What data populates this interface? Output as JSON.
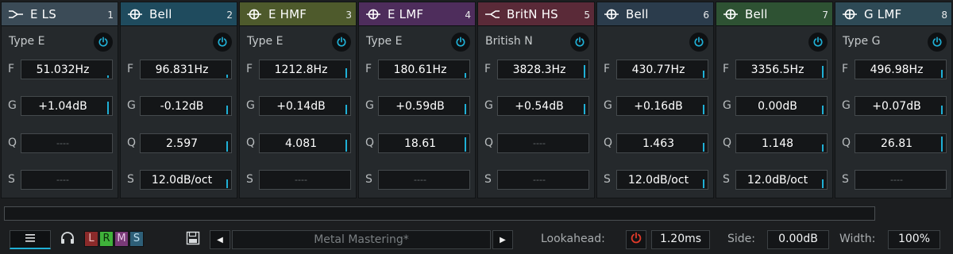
{
  "colors": {
    "accent": "#1fb0d6",
    "power_off": "#e03a2a"
  },
  "bands": [
    {
      "num": "1",
      "name": "E LS",
      "icon": "low-shelf-icon",
      "header_color": "#3b4b57",
      "type": "Type E",
      "params": [
        {
          "label": "F",
          "value": "51.032Hz",
          "bar": 0.12,
          "empty": false
        },
        {
          "label": "G",
          "value": "+1.04dB",
          "bar": 0.75,
          "empty": false
        },
        {
          "label": "Q",
          "value": "----",
          "bar": 0,
          "empty": true
        },
        {
          "label": "S",
          "value": "----",
          "bar": 0,
          "empty": true
        }
      ]
    },
    {
      "num": "2",
      "name": "Bell",
      "icon": "bell-icon",
      "header_color": "#1f4b5e",
      "type": "",
      "params": [
        {
          "label": "F",
          "value": "96.831Hz",
          "bar": 0.2,
          "empty": false
        },
        {
          "label": "G",
          "value": "-0.12dB",
          "bar": 0.5,
          "empty": false
        },
        {
          "label": "Q",
          "value": "2.597",
          "bar": 0.6,
          "empty": false
        },
        {
          "label": "S",
          "value": "12.0dB/oct",
          "bar": 0.5,
          "empty": false
        }
      ]
    },
    {
      "num": "3",
      "name": "E HMF",
      "icon": "bell-icon",
      "header_color": "#4e5a2c",
      "type": "Type E",
      "params": [
        {
          "label": "F",
          "value": "1212.8Hz",
          "bar": 0.55,
          "empty": false
        },
        {
          "label": "G",
          "value": "+0.14dB",
          "bar": 0.55,
          "empty": false
        },
        {
          "label": "Q",
          "value": "4.081",
          "bar": 0.7,
          "empty": false
        },
        {
          "label": "S",
          "value": "----",
          "bar": 0,
          "empty": true
        }
      ]
    },
    {
      "num": "4",
      "name": "E LMF",
      "icon": "bell-icon",
      "header_color": "#4e2d5c",
      "type": "Type E",
      "params": [
        {
          "label": "F",
          "value": "180.61Hz",
          "bar": 0.3,
          "empty": false
        },
        {
          "label": "G",
          "value": "+0.59dB",
          "bar": 0.6,
          "empty": false
        },
        {
          "label": "Q",
          "value": "18.61",
          "bar": 0.85,
          "empty": false
        },
        {
          "label": "S",
          "value": "----",
          "bar": 0,
          "empty": true
        }
      ]
    },
    {
      "num": "5",
      "name": "BritN HS",
      "icon": "high-shelf-icon",
      "header_color": "#5a2a38",
      "type": "British N",
      "params": [
        {
          "label": "F",
          "value": "3828.3Hz",
          "bar": 0.75,
          "empty": false
        },
        {
          "label": "G",
          "value": "+0.54dB",
          "bar": 0.6,
          "empty": false
        },
        {
          "label": "Q",
          "value": "----",
          "bar": 0,
          "empty": true
        },
        {
          "label": "S",
          "value": "----",
          "bar": 0,
          "empty": true
        }
      ]
    },
    {
      "num": "6",
      "name": "Bell",
      "icon": "bell-icon",
      "header_color": "#2b3c4c",
      "type": "",
      "params": [
        {
          "label": "F",
          "value": "430.77Hz",
          "bar": 0.45,
          "empty": false
        },
        {
          "label": "G",
          "value": "+0.16dB",
          "bar": 0.55,
          "empty": false
        },
        {
          "label": "Q",
          "value": "1.463",
          "bar": 0.5,
          "empty": false
        },
        {
          "label": "S",
          "value": "12.0dB/oct",
          "bar": 0.5,
          "empty": false
        }
      ]
    },
    {
      "num": "7",
      "name": "Bell",
      "icon": "bell-icon",
      "header_color": "#2e5233",
      "type": "",
      "params": [
        {
          "label": "F",
          "value": "3356.5Hz",
          "bar": 0.72,
          "empty": false
        },
        {
          "label": "G",
          "value": "0.00dB",
          "bar": 0.5,
          "empty": false
        },
        {
          "label": "Q",
          "value": "1.148",
          "bar": 0.45,
          "empty": false
        },
        {
          "label": "S",
          "value": "12.0dB/oct",
          "bar": 0.5,
          "empty": false
        }
      ]
    },
    {
      "num": "8",
      "name": "G LMF",
      "icon": "bell-icon",
      "header_color": "#2e4a56",
      "type": "Type G",
      "params": [
        {
          "label": "F",
          "value": "496.98Hz",
          "bar": 0.48,
          "empty": false
        },
        {
          "label": "G",
          "value": "+0.07dB",
          "bar": 0.52,
          "empty": false
        },
        {
          "label": "Q",
          "value": "26.81",
          "bar": 0.9,
          "empty": false
        },
        {
          "label": "S",
          "value": "----",
          "bar": 0,
          "empty": true
        }
      ]
    }
  ],
  "bottom": {
    "menu_icon": "menu-icon",
    "channels": [
      {
        "label": "L",
        "color": "#8b2a2a",
        "text_color": "#f0c0c0"
      },
      {
        "label": "R",
        "color": "#3fb23a",
        "text_color": "#0c2a0a"
      },
      {
        "label": "M",
        "color": "#7a3a78",
        "text_color": "#e8c8e8"
      },
      {
        "label": "S",
        "color": "#2e5f78",
        "text_color": "#c0e0f0"
      }
    ],
    "preset_name": "Metal Mastering*",
    "lookahead_label": "Lookahead:",
    "lookahead_value": "1.20ms",
    "side_label": "Side:",
    "side_value": "0.00dB",
    "width_label": "Width:",
    "width_value": "100%"
  }
}
